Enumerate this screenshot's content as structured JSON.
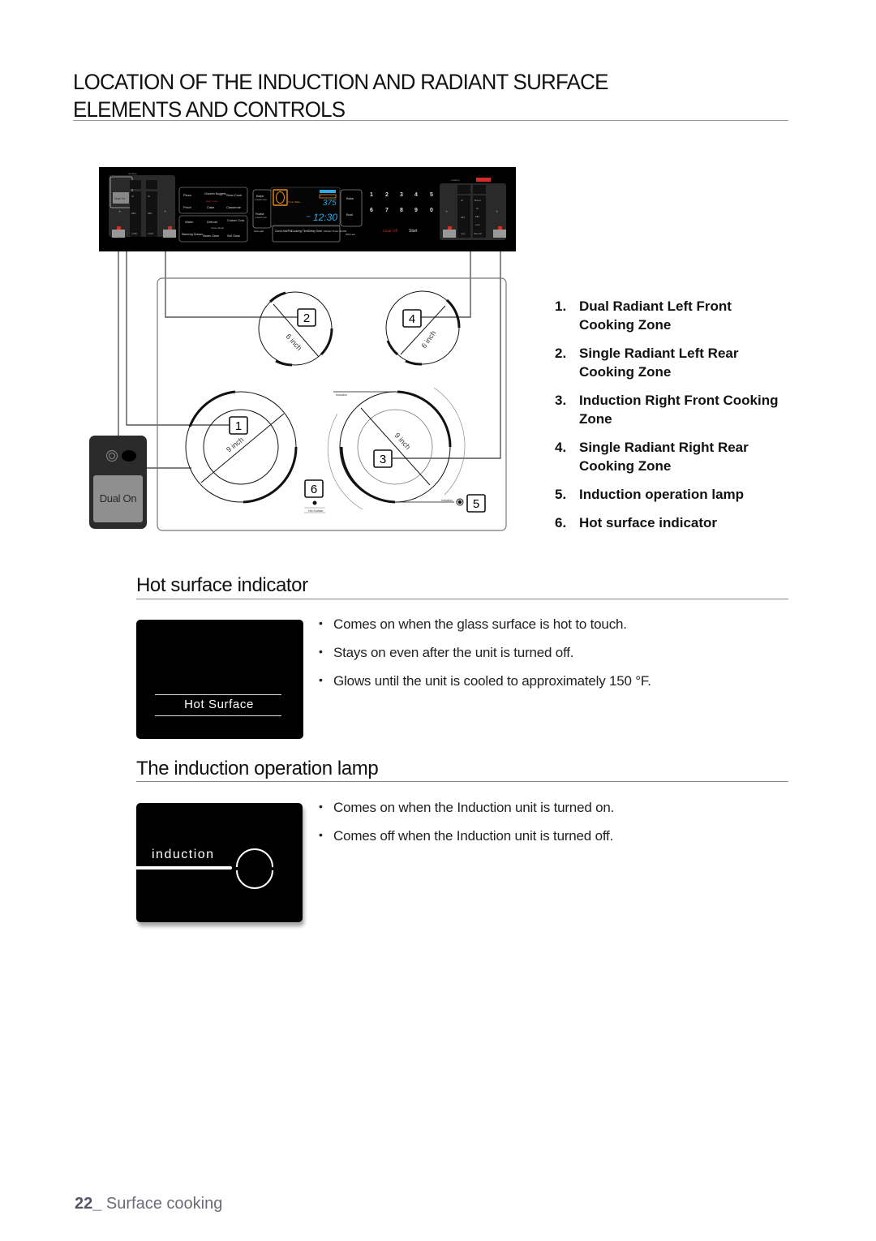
{
  "title": {
    "line1": "LOCATION OF THE INDUCTION AND RADIANT SURFACE",
    "line2": "ELEMENTS AND CONTROLS"
  },
  "control_panel": {
    "left_labels": {
      "cooktop": "cooktop",
      "dual_on": "Dual On",
      "hi": "HI",
      "mid": "MID",
      "low": "LOW",
      "on_off": "ON/OFF",
      "plus": "+",
      "minus": "—",
      "left_front": "Left front",
      "left_rear": "Left rear"
    },
    "oven_buttons": {
      "row1": [
        "Pizza",
        "Chicken Nuggets",
        "Slow Cook"
      ],
      "easy_cook": "Easy Cook",
      "row2": [
        "Proof",
        "Cake",
        "Casserole"
      ],
      "row3": [
        "Warm",
        "Defrost",
        "Custom Cook"
      ],
      "clean_mode": "Clean Mode",
      "row4": [
        "Warming Drawer",
        "Steam Clean",
        "Self Clean"
      ]
    },
    "mode_buttons": {
      "bake": "Bake",
      "bake_sub": "CONVECTION",
      "roast": "Roast",
      "roast_sub": "CONVECTION",
      "oven_light": "Oven Light"
    },
    "display": {
      "temp": "375",
      "time": "12:30",
      "conv_bake": "Conv. Bake",
      "pm": "PM"
    },
    "bottom_buttons": [
      "Clock AM/PM",
      "Cooking Time",
      "Delay Start",
      "Kitchen Timer On/Off"
    ],
    "right_mode_buttons": [
      "Bake",
      "Broil"
    ],
    "hold_start": "Hold 3 sec",
    "number_keys": [
      "1",
      "2",
      "3",
      "4",
      "5",
      "6",
      "7",
      "8",
      "9",
      "0"
    ],
    "clear_off": "Clear Off",
    "start": "Start",
    "set": "Set",
    "right_labels": {
      "cooktop": "cooktop",
      "induction": "induction",
      "boost": "Boost",
      "hi": "HI",
      "mid": "Mid",
      "low": "Low",
      "simmer": "Simmer",
      "on_off": "ON/OFF",
      "right_rear": "Right rear",
      "right_front": "Right front"
    },
    "accent_color": "#e8891c",
    "display_color": "#2fa8e0",
    "red_color": "#d42b2b"
  },
  "cooktop": {
    "zones": [
      {
        "callout": "1",
        "size_label": "9 inch"
      },
      {
        "callout": "2",
        "size_label": "6 inch"
      },
      {
        "callout": "3",
        "size_label": "9 inch"
      },
      {
        "callout": "4",
        "size_label": "6 inch"
      }
    ],
    "lamp_callout": "5",
    "indicator_callout": "6",
    "induction_small_label": "Induction",
    "hot_surface_small_label": "Hot Surface",
    "dual_on_label": "Dual On"
  },
  "legend": [
    {
      "num": "1.",
      "text": "Dual Radiant Left Front Cooking Zone"
    },
    {
      "num": "2.",
      "text": "Single Radiant Left Rear Cooking Zone"
    },
    {
      "num": "3.",
      "text": "Induction Right Front Cooking Zone"
    },
    {
      "num": "4.",
      "text": "Single Radiant Right Rear Cooking Zone"
    },
    {
      "num": "5.",
      "text": "Induction operation lamp"
    },
    {
      "num": "6.",
      "text": "Hot surface indicator"
    }
  ],
  "hot_surface": {
    "heading": "Hot surface indicator",
    "box_label": "Hot Surface",
    "bullets": [
      "Comes on when the glass surface is hot to touch.",
      "Stays on even after the unit is turned off.",
      "Glows until the unit is cooled to approximately 150 °F."
    ]
  },
  "induction_lamp": {
    "heading": "The induction operation lamp",
    "box_label": "induction",
    "bullets": [
      "Comes on when the Induction unit is turned on.",
      "Comes off when the Induction unit is turned off."
    ]
  },
  "footer": {
    "page_number": "22_",
    "section": " Surface cooking"
  }
}
